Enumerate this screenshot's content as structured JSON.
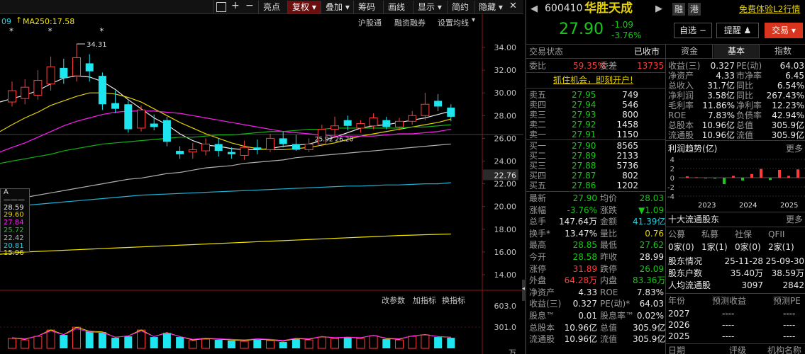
{
  "toolbar": {
    "items": [
      "亮点",
      "复权",
      "叠加",
      "筹码",
      "画线",
      "显示",
      "简约",
      "隐藏"
    ],
    "active": "复权"
  },
  "chart": {
    "ma_partial": "09",
    "ma250_label": "MA250:17.58",
    "subbar_links": [
      "沪股通",
      "融资融券",
      "设置均线"
    ],
    "indicator_links": [
      "改参数",
      "加指标",
      "换指标"
    ],
    "high_label": "34.31",
    "low_label": "25.92 26.20",
    "current_price_tag": "22.76",
    "price_axis": [
      "34.00",
      "32.00",
      "30.00",
      "28.00",
      "26.00",
      "24.00",
      "22.00",
      "20.00",
      "18.00",
      "16.00",
      "14.00"
    ],
    "volume_axis": [
      "603.0",
      "301.0",
      "万"
    ],
    "popup": [
      "A———",
      "28.59",
      "29.60",
      "27.84",
      "25.72",
      "22.42",
      "20.81",
      "15.96"
    ]
  },
  "chart_data": {
    "type": "candlestick",
    "title": "",
    "ylim": [
      13,
      35
    ],
    "candles": [
      {
        "o": 29.2,
        "c": 30.2,
        "h": 31.0,
        "l": 28.8
      },
      {
        "o": 29.5,
        "c": 30.5,
        "h": 31.2,
        "l": 29.0
      },
      {
        "o": 29.8,
        "c": 31.1,
        "h": 32.0,
        "l": 29.4
      },
      {
        "o": 30.8,
        "c": 32.3,
        "h": 33.2,
        "l": 30.2
      },
      {
        "o": 32.2,
        "c": 31.3,
        "h": 33.0,
        "l": 30.8
      },
      {
        "o": 31.5,
        "c": 33.1,
        "h": 34.31,
        "l": 31.0
      },
      {
        "o": 32.6,
        "c": 31.9,
        "h": 33.4,
        "l": 31.0
      },
      {
        "o": 31.5,
        "c": 29.0,
        "h": 31.8,
        "l": 28.5
      },
      {
        "o": 29.1,
        "c": 28.6,
        "h": 30.2,
        "l": 28.2
      },
      {
        "o": 29.0,
        "c": 26.8,
        "h": 29.3,
        "l": 26.5
      },
      {
        "o": 26.9,
        "c": 28.5,
        "h": 28.9,
        "l": 26.6
      },
      {
        "o": 27.3,
        "c": 27.0,
        "h": 28.1,
        "l": 26.7
      },
      {
        "o": 27.6,
        "c": 25.7,
        "h": 27.9,
        "l": 25.3
      },
      {
        "o": 24.9,
        "c": 24.6,
        "h": 25.3,
        "l": 24.2
      },
      {
        "o": 24.8,
        "c": 25.0,
        "h": 25.6,
        "l": 24.2
      },
      {
        "o": 24.9,
        "c": 25.5,
        "h": 26.0,
        "l": 24.5
      },
      {
        "o": 25.5,
        "c": 24.9,
        "h": 26.0,
        "l": 24.4
      },
      {
        "o": 24.8,
        "c": 24.6,
        "h": 25.2,
        "l": 24.2
      },
      {
        "o": 24.5,
        "c": 25.2,
        "h": 25.8,
        "l": 24.1
      },
      {
        "o": 25.2,
        "c": 25.0,
        "h": 25.9,
        "l": 24.6
      },
      {
        "o": 25.0,
        "c": 26.0,
        "h": 26.4,
        "l": 24.8
      },
      {
        "o": 26.0,
        "c": 25.5,
        "h": 26.6,
        "l": 25.2
      },
      {
        "o": 25.5,
        "c": 25.0,
        "h": 26.3,
        "l": 24.9
      },
      {
        "o": 25.0,
        "c": 25.5,
        "h": 26.0,
        "l": 24.8
      },
      {
        "o": 25.5,
        "c": 26.8,
        "h": 27.2,
        "l": 25.3
      },
      {
        "o": 26.8,
        "c": 27.1,
        "h": 27.9,
        "l": 26.0
      },
      {
        "o": 27.6,
        "c": 27.1,
        "h": 28.0,
        "l": 26.7
      },
      {
        "o": 26.9,
        "c": 27.3,
        "h": 27.6,
        "l": 26.5
      },
      {
        "o": 27.1,
        "c": 27.8,
        "h": 28.2,
        "l": 26.8
      },
      {
        "o": 27.6,
        "c": 27.0,
        "h": 27.9,
        "l": 26.8
      },
      {
        "o": 27.0,
        "c": 27.5,
        "h": 27.8,
        "l": 26.7
      },
      {
        "o": 27.5,
        "c": 28.0,
        "h": 28.4,
        "l": 27.2
      },
      {
        "o": 28.0,
        "c": 29.0,
        "h": 30.0,
        "l": 27.6
      },
      {
        "o": 29.3,
        "c": 28.8,
        "h": 29.9,
        "l": 28.4
      },
      {
        "o": 28.7,
        "c": 27.9,
        "h": 29.0,
        "l": 27.5
      }
    ],
    "volumes": [
      140,
      120,
      170,
      260,
      190,
      300,
      240,
      230,
      150,
      170,
      260,
      160,
      220,
      160,
      110,
      130,
      120,
      110,
      100,
      120,
      110,
      90,
      130,
      120,
      160,
      140,
      150,
      140,
      180,
      130,
      120,
      170,
      190,
      160,
      150
    ],
    "volume_max": 603,
    "ma_lines": [
      {
        "name": "MA5",
        "color": "#e8e8e8",
        "values": [
          29.5,
          29.8,
          30.2,
          30.8,
          31.3,
          31.5,
          31.4,
          31.0,
          30.3,
          29.4,
          28.6,
          27.8,
          27.2,
          26.4,
          25.8,
          25.4,
          25.3,
          25.1,
          25.0,
          25.0,
          25.1,
          25.3,
          25.4,
          25.5,
          25.8,
          26.1,
          26.5,
          26.9,
          27.1,
          27.2,
          27.4,
          27.6,
          27.8,
          28.1,
          28.4
        ]
      },
      {
        "name": "MA10",
        "color": "#e6d200",
        "values": [
          27.2,
          27.8,
          28.3,
          28.9,
          29.3,
          29.7,
          30.0,
          30.0,
          29.9,
          29.6,
          29.2,
          28.6,
          28.0,
          27.4,
          26.9,
          26.4,
          26.0,
          25.6,
          25.3,
          25.1,
          25.0,
          25.0,
          25.1,
          25.2,
          25.4,
          25.6,
          25.9,
          26.2,
          26.4,
          26.6,
          26.8,
          27.0,
          27.2,
          27.4,
          27.7
        ]
      },
      {
        "name": "MA20",
        "color": "#ff1cf4",
        "values": [
          25.2,
          25.6,
          26.1,
          26.6,
          27.1,
          27.5,
          27.8,
          28.1,
          28.3,
          28.4,
          28.4,
          28.4,
          28.3,
          28.2,
          28.0,
          27.8,
          27.6,
          27.4,
          27.2,
          27.0,
          26.8,
          26.6,
          26.5,
          26.4,
          26.3,
          26.2,
          26.2,
          26.2,
          26.2,
          26.3,
          26.4,
          26.4,
          26.5,
          26.6,
          26.8
        ]
      },
      {
        "name": "MA30",
        "color": "#12b212",
        "values": [
          24.0,
          24.2,
          24.4,
          24.6,
          24.9,
          25.1,
          25.3,
          25.5,
          25.6,
          25.7,
          25.8,
          25.9,
          26.0,
          26.1,
          26.1,
          26.2,
          26.3,
          26.3,
          26.4,
          26.5,
          26.6,
          26.6,
          26.7,
          26.8,
          26.8,
          26.9,
          26.9,
          26.9,
          26.9,
          26.9,
          26.9,
          27.0,
          27.0,
          27.1,
          27.2
        ]
      },
      {
        "name": "MA60",
        "color": "#b0b0b0",
        "values": [
          20.6,
          20.8,
          21.0,
          21.2,
          21.4,
          21.6,
          21.8,
          22.0,
          22.2,
          22.4,
          22.5,
          22.7,
          22.9,
          23.0,
          23.2,
          23.4,
          23.5,
          23.6,
          23.8,
          23.9,
          24.0,
          24.1,
          24.3,
          24.4,
          24.5,
          24.6,
          24.7,
          24.8,
          24.9,
          25.0,
          25.1,
          25.2,
          25.3,
          25.4,
          25.5
        ]
      },
      {
        "name": "MA120",
        "color": "#1fb2d4",
        "values": [
          20.0,
          20.1,
          20.2,
          20.3,
          20.4,
          20.5,
          20.6,
          20.7,
          20.8,
          20.9,
          21.0,
          21.05,
          21.1,
          21.15,
          21.2,
          21.25,
          21.3,
          21.35,
          21.4,
          21.45,
          21.5,
          21.55,
          21.6,
          21.65,
          21.7,
          21.75,
          21.8,
          21.8,
          21.85,
          21.9,
          21.9,
          21.95,
          22.0,
          22.0,
          22.1
        ]
      },
      {
        "name": "MA250",
        "color": "#f2e600",
        "values": [
          15.9,
          16.0,
          16.05,
          16.1,
          16.15,
          16.2,
          16.25,
          16.3,
          16.35,
          16.4,
          16.45,
          16.5,
          16.55,
          16.6,
          16.65,
          16.7,
          16.75,
          16.8,
          16.85,
          16.9,
          16.95,
          17.0,
          17.05,
          17.1,
          17.15,
          17.2,
          17.25,
          17.3,
          17.35,
          17.4,
          17.45,
          17.48,
          17.52,
          17.55,
          17.58
        ]
      }
    ]
  },
  "quote": {
    "code": "600410",
    "name": "华胜天成",
    "tag1": "融",
    "tag2": "港",
    "promo": "免费体验L2行情",
    "price": "27.90",
    "change": "-1.09",
    "change_pct": "-3.76%",
    "watch_btn": "自选",
    "remind_btn": "提醒",
    "trade_btn": "交易",
    "status_label": "交易状态",
    "status_value": "已收市",
    "wb_label": "委比",
    "wb_value": "59.35%",
    "wc_label": "委差",
    "wc_value": "13735",
    "ad": "抓住机会，即刻开户!",
    "asks": [
      {
        "label": "卖五",
        "price": "27.95",
        "vol": "749"
      },
      {
        "label": "卖四",
        "price": "27.94",
        "vol": "546"
      },
      {
        "label": "卖三",
        "price": "27.93",
        "vol": "800"
      },
      {
        "label": "卖二",
        "price": "27.92",
        "vol": "1458"
      },
      {
        "label": "卖一",
        "price": "27.91",
        "vol": "1150"
      }
    ],
    "bids": [
      {
        "label": "买一",
        "price": "27.90",
        "vol": "8565"
      },
      {
        "label": "买二",
        "price": "27.89",
        "vol": "2133"
      },
      {
        "label": "买三",
        "price": "27.88",
        "vol": "5736"
      },
      {
        "label": "买四",
        "price": "27.87",
        "vol": "802"
      },
      {
        "label": "买五",
        "price": "27.86",
        "vol": "1202"
      }
    ],
    "stats": [
      {
        "l1": "最新",
        "v1": "27.90",
        "c1": "green",
        "l2": "均价",
        "v2": "28.03",
        "c2": "green"
      },
      {
        "l1": "涨幅",
        "v1": "-3.76%",
        "c1": "green",
        "l2": "涨跌",
        "v2": "▼1.09",
        "c2": "green"
      },
      {
        "l1": "总手",
        "v1": "147.64万",
        "c1": "white",
        "l2": "金额",
        "v2": "41.39亿",
        "c2": "cyan"
      },
      {
        "l1": "换手*",
        "v1": "13.47%",
        "c1": "white",
        "l2": "量比",
        "v2": "0.76",
        "c2": "yellow"
      },
      {
        "l1": "最高",
        "v1": "28.85",
        "c1": "green",
        "l2": "最低",
        "v2": "27.62",
        "c2": "green"
      },
      {
        "l1": "今开",
        "v1": "28.58",
        "c1": "green",
        "l2": "昨收",
        "v2": "28.99",
        "c2": "white"
      },
      {
        "l1": "涨停",
        "v1": "31.89",
        "c1": "red",
        "l2": "跌停",
        "v2": "26.09",
        "c2": "green"
      },
      {
        "l1": "外盘",
        "v1": "64.28万",
        "c1": "red",
        "l2": "内盘",
        "v2": "83.36万",
        "c2": "green"
      },
      {
        "l1": "净资产",
        "v1": "4.33",
        "c1": "white",
        "l2": "ROE",
        "v2": "7.83%",
        "c2": "white"
      },
      {
        "l1": "收益(三)",
        "v1": "0.327",
        "c1": "white",
        "l2": "PE(动)*",
        "v2": "64.03",
        "c2": "white"
      },
      {
        "l1": "股息™",
        "v1": "0.01",
        "c1": "white",
        "l2": "股息率™",
        "v2": "0.02%",
        "c2": "white"
      },
      {
        "l1": "总股本",
        "v1": "10.96亿",
        "c1": "white",
        "l2": "总值",
        "v2": "305.9亿",
        "c2": "white"
      },
      {
        "l1": "流通股",
        "v1": "10.96亿",
        "c1": "white",
        "l2": "流值",
        "v2": "305.9亿",
        "c2": "white"
      }
    ]
  },
  "fundamentals": {
    "tabs": [
      "资金",
      "基本",
      "指数"
    ],
    "active_tab": "基本",
    "rows": [
      {
        "l1": "收益(三)",
        "v1": "0.327",
        "l2": "PE(动)",
        "v2": "64.03"
      },
      {
        "l1": "净资产",
        "v1": "4.33",
        "l2": "市净率",
        "v2": "6.45"
      },
      {
        "l1": "总收入",
        "v1": "31.7亿",
        "l2": "同比",
        "v2": "6.54%"
      },
      {
        "l1": "净利润",
        "v1": "3.58亿",
        "l2": "同比",
        "v2": "267.43%"
      },
      {
        "l1": "毛利率",
        "v1": "11.86%",
        "l2": "净利率",
        "v2": "12.23%"
      },
      {
        "l1": "ROE",
        "v1": "7.83%",
        "l2": "负债率",
        "v2": "42.94%"
      },
      {
        "l1": "总股本",
        "v1": "10.96亿",
        "l2": "总值",
        "v2": "305.9亿"
      },
      {
        "l1": "流通股",
        "v1": "10.96亿",
        "l2": "流值",
        "v2": "305.9亿"
      }
    ],
    "profit_title": "利润趋势(亿)",
    "more": "更多",
    "profit_axis": [
      "4",
      "2",
      "0",
      "-2",
      "-4"
    ],
    "profit_years": [
      "2023",
      "2024",
      "2025"
    ],
    "profit_bars": [
      0.3,
      0.1,
      -0.1,
      -0.2,
      -1.4,
      0.4,
      -0.6,
      0.8,
      1.9,
      -0.5,
      1.7,
      0.4,
      1.8
    ],
    "holders_title": "十大流通股东",
    "holders_cols": [
      "公募",
      "私募",
      "社保",
      "QFII"
    ],
    "holders_vals": [
      "0家(0)",
      "1家(1)",
      "0家(0)",
      "2家(1)"
    ],
    "holder_rows": [
      {
        "l": "股东情况",
        "v1": "25-11-28",
        "v2": "25-09-30"
      },
      {
        "l": "股东户数",
        "v1": "35.40万",
        "v2": "38.59万"
      },
      {
        "l": "人均流通股",
        "v1": "3097",
        "v2": "2842"
      }
    ],
    "forecast_cols": [
      "年份",
      "预测收益",
      "预测PE"
    ],
    "forecast_rows": [
      {
        "year": "2027",
        "e": "----",
        "pe": "----"
      },
      {
        "year": "2026",
        "e": "----",
        "pe": "----"
      },
      {
        "year": "2025",
        "e": "----",
        "pe": "----"
      }
    ],
    "bottom_cols": [
      "日期",
      "评级",
      "机构名称"
    ]
  }
}
